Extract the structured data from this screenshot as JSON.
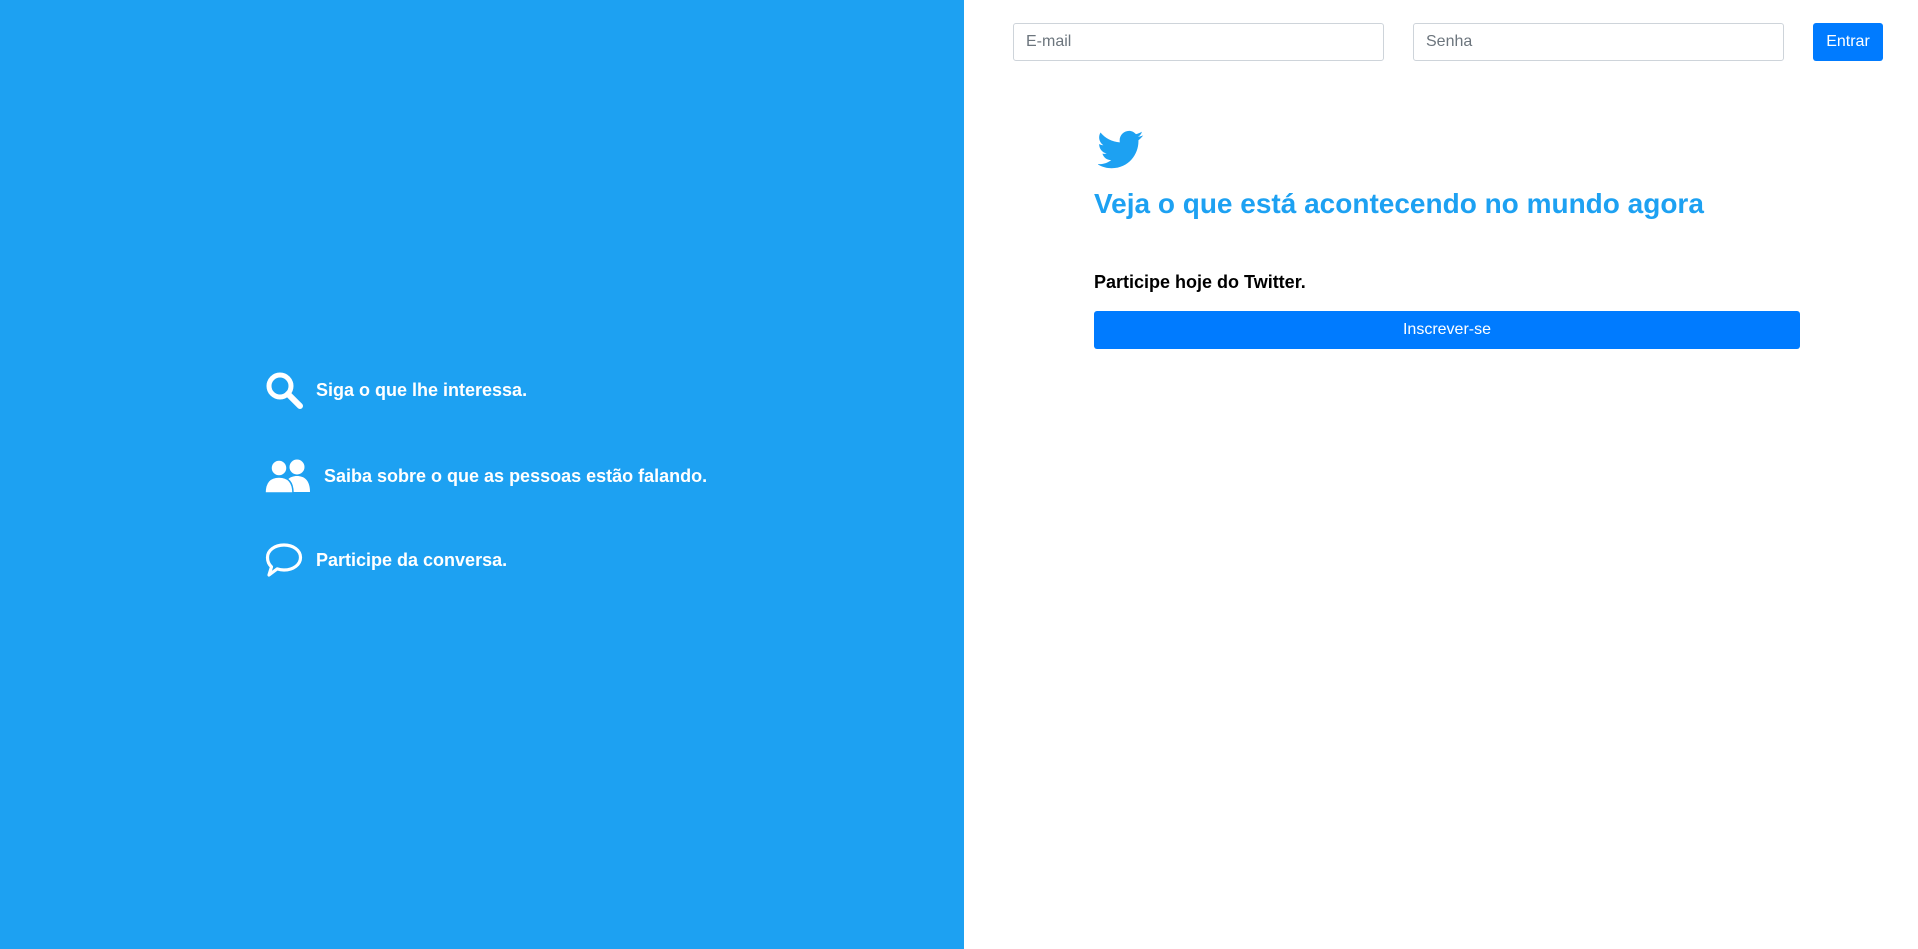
{
  "features": [
    {
      "icon": "search-icon",
      "text": "Siga o que lhe interessa."
    },
    {
      "icon": "people-icon",
      "text": "Saiba sobre o que as pessoas estão falando."
    },
    {
      "icon": "chat-bubble-icon",
      "text": "Participe da conversa."
    }
  ],
  "login": {
    "email_placeholder": "E-mail",
    "email_value": "",
    "password_placeholder": "Senha",
    "password_value": "",
    "submit_label": "Entrar"
  },
  "main": {
    "logo_icon": "twitter-bird-icon",
    "headline": "Veja o que está acontecendo no mundo agora",
    "subhead": "Participe hoje do Twitter.",
    "signup_label": "Inscrever-se"
  },
  "colors": {
    "brand_blue": "#1da1f2",
    "button_blue": "#007bff",
    "white": "#ffffff",
    "text_dark": "#000000"
  }
}
